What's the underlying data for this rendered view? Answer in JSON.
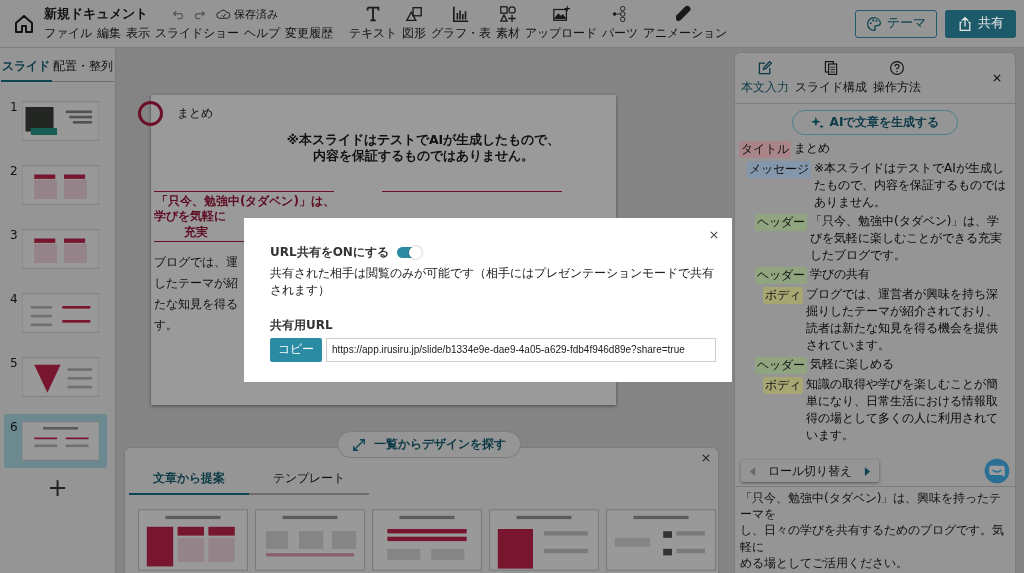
{
  "header": {
    "document_title": "新規ドキュメント",
    "menu": [
      "ファイル",
      "編集",
      "表示",
      "スライドショー",
      "ヘルプ",
      "変更履歴"
    ],
    "save_status": "保存済み",
    "toolbar": [
      "テキスト",
      "図形",
      "グラフ・表",
      "素材",
      "アップロード",
      "パーツ",
      "アニメーション"
    ],
    "theme_button": "テーマ",
    "share_button": "共有"
  },
  "sidebar": {
    "tabs": [
      {
        "label": "スライド",
        "selected": true
      },
      {
        "label": "配置・整列",
        "selected": false
      }
    ],
    "slides": [
      {
        "number": "1",
        "kind": "cover",
        "selected": false
      },
      {
        "number": "2",
        "kind": "cards",
        "selected": false
      },
      {
        "number": "3",
        "kind": "cards",
        "selected": false
      },
      {
        "number": "4",
        "kind": "list",
        "selected": false
      },
      {
        "number": "5",
        "kind": "funnel",
        "selected": false
      },
      {
        "number": "6",
        "kind": "summary",
        "selected": true
      }
    ],
    "add_button": "+"
  },
  "slide": {
    "title": "まとめ",
    "message": [
      "※本スライドはテストでAIが生成したもので、",
      "内容を保証するものではありません。"
    ],
    "header_lines": [
      "「只今、勉強中(タダベン)」は、",
      "学びを気軽に",
      "充実"
    ],
    "body_lines": [
      "ブログでは、運",
      "したテーマが紹",
      "たな知見を得る",
      "す。"
    ]
  },
  "design_button": "一覧からデザインを探す",
  "design_panel": {
    "tabs": [
      {
        "label": "文章から提案",
        "selected": true
      },
      {
        "label": "テンプレート",
        "selected": false
      }
    ],
    "templates": [
      {
        "kind": "columns"
      },
      {
        "kind": "text"
      },
      {
        "kind": "header"
      },
      {
        "kind": "block"
      },
      {
        "kind": "icons"
      }
    ]
  },
  "right_panel": {
    "tabs": [
      {
        "label": "本文入力",
        "selected": true
      },
      {
        "label": "スライド構成",
        "selected": false
      },
      {
        "label": "操作方法",
        "selected": false
      }
    ],
    "ai_button": "AIで文章を生成する",
    "outline": [
      {
        "tag": "タイトル",
        "color": "#a98589",
        "text": "まとめ",
        "children": [
          {
            "tag": "メッセージ",
            "color": "#8497aa",
            "text": "※本スライドはテストでAIが生成したもので、内容を保証するものではありません。",
            "children": [
              {
                "tag": "ヘッダー",
                "color": "#8fa47f",
                "text": "「只今、勉強中(タダベン)」は、学びを気軽に楽しむことができる充実したブログです。"
              },
              {
                "tag": "ヘッダー",
                "color": "#8fa47f",
                "text": "学びの共有",
                "children": [
                  {
                    "tag": "ボディ",
                    "color": "#a6a672",
                    "text": "ブログでは、運営者が興味を持ち深掘りしたテーマが紹介されており、読者は新たな知見を得る機会を提供されています。"
                  }
                ]
              },
              {
                "tag": "ヘッダー",
                "color": "#8fa47f",
                "text": "気軽に楽しめる",
                "children": [
                  {
                    "tag": "ボディ",
                    "color": "#a6a672",
                    "text": "知識の取得や学びを楽しむことが簡単になり、日常生活における情報取得の場として多くの人に利用されています。"
                  }
                ]
              }
            ]
          }
        ]
      }
    ],
    "role_switch": "ロール切り替え",
    "note_lines": [
      "「只今、勉強中(タダベン)」は、興味を持ったテーマを",
      "し、日々の学びを共有するためのブログです。気軽に",
      "める場としてご活用ください。"
    ]
  },
  "modal": {
    "toggle_label": "URL共有をONにする",
    "on": true,
    "note": "共有された相手は閲覧のみが可能です（相手にはプレゼンテーションモードで共有されます）",
    "url_label": "共有用URL",
    "copy_button": "コピー",
    "url": "https://app.irusiru.jp/slide/b1334e9e-dae9-4a05-a629-fdb4f946d89e?share=true"
  }
}
